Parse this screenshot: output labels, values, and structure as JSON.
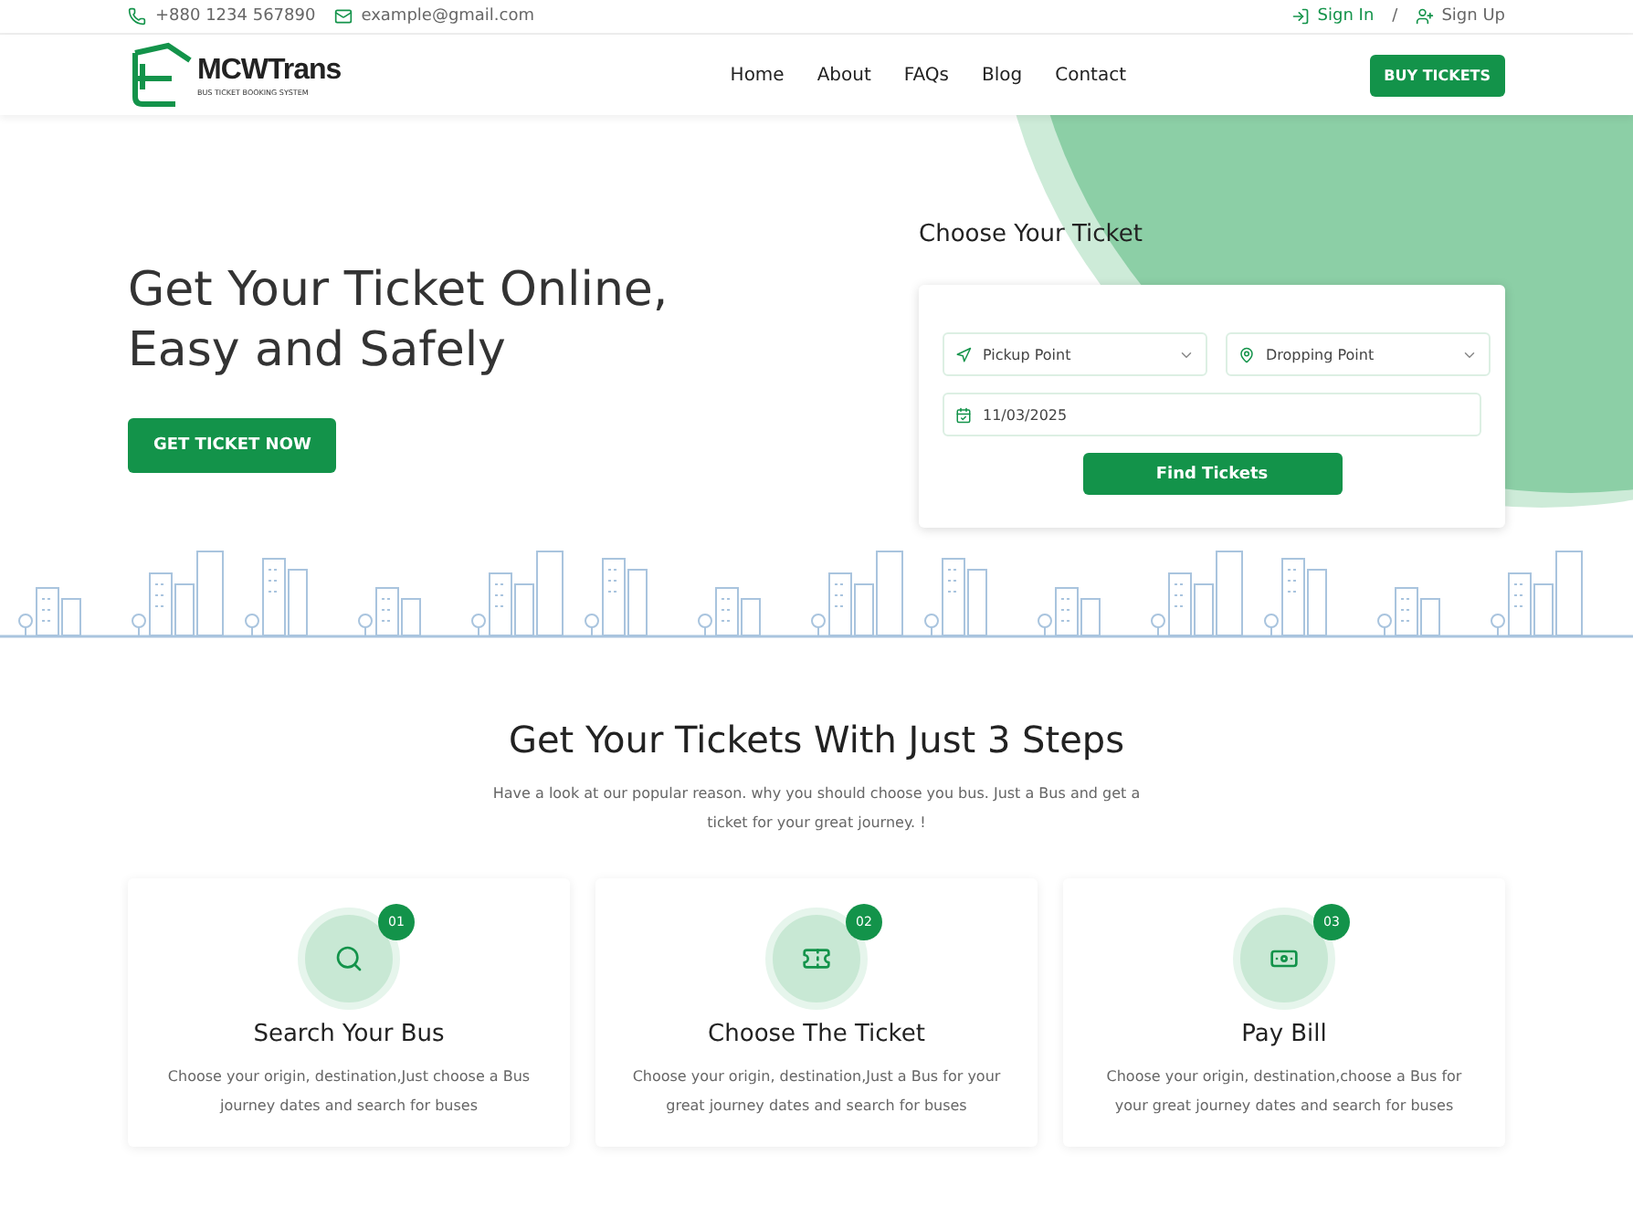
{
  "topbar": {
    "phone": "+880 1234 567890",
    "email": "example@gmail.com",
    "sign_in": "Sign In",
    "separator": "/",
    "sign_up": "Sign Up"
  },
  "header": {
    "logo": {
      "name": "MCWTrans",
      "tagline": "BUS TICKET BOOKING SYSTEM"
    },
    "nav": [
      {
        "label": "Home"
      },
      {
        "label": "About"
      },
      {
        "label": "FAQs"
      },
      {
        "label": "Blog"
      },
      {
        "label": "Contact"
      }
    ],
    "cta": "BUY TICKETS"
  },
  "hero": {
    "title": "Get Your Ticket Online,\nEasy and Safely",
    "button": "GET TICKET NOW"
  },
  "ticket_form": {
    "title": "Choose Your Ticket",
    "pickup": {
      "placeholder": "Pickup Point"
    },
    "dropping": {
      "placeholder": "Dropping Point"
    },
    "date": {
      "value": "11/03/2025"
    },
    "button": "Find Tickets"
  },
  "steps": {
    "title": "Get Your Tickets With Just 3 Steps",
    "subtitle": "Have a look at our popular reason. why you should choose you bus. Just a Bus and get a ticket for your great journey. !",
    "items": [
      {
        "kind": "search",
        "number": "01",
        "title": "Search Your Bus",
        "text": "Choose your origin, destination,Just choose a Bus journey dates and search for buses"
      },
      {
        "kind": "ticket",
        "number": "02",
        "title": "Choose The Ticket",
        "text": "Choose your origin, destination,Just a Bus for your great journey dates and search for buses"
      },
      {
        "kind": "pay",
        "number": "03",
        "title": "Pay Bill",
        "text": "Choose your origin, destination,choose a Bus for your great journey dates and search for buses"
      }
    ]
  }
}
